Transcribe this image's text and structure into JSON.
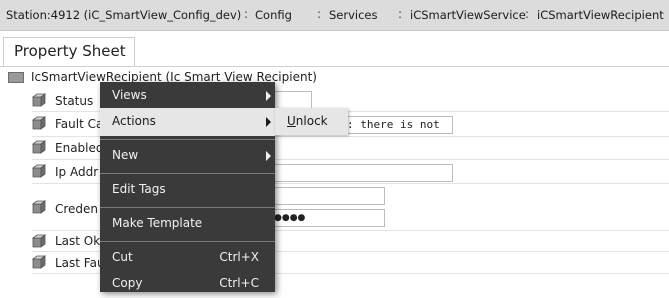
{
  "breadcrumb": {
    "station": "Station:4912 (iC_SmartView_Config_dev)",
    "items": [
      "Config",
      "Services",
      "iCSmartViewService",
      "iCSmartViewRecipient"
    ]
  },
  "tab": {
    "label": "Property Sheet"
  },
  "root": {
    "label": "IcSmartViewRecipient  (Ic Smart View Recipient)"
  },
  "properties": [
    {
      "label": "Status",
      "value": ""
    },
    {
      "label": "Fault Ca",
      "value": ": there is not"
    },
    {
      "label": "Enabled",
      "value": ""
    },
    {
      "label": "Ip Addr",
      "value": ""
    },
    {
      "label": "Creden",
      "value": "",
      "password": "●●●●"
    },
    {
      "label": "Last Ok",
      "value": ""
    },
    {
      "label": "Last Fau",
      "value": ""
    }
  ],
  "menu": {
    "views": "Views",
    "actions": "Actions",
    "new": "New",
    "edit_tags": "Edit Tags",
    "make_template": "Make Template",
    "cut": "Cut",
    "cut_shortcut": "Ctrl+X",
    "copy": "Copy",
    "copy_shortcut": "Ctrl+C"
  },
  "submenu": {
    "unlock_mnemonic": "U",
    "unlock_rest": "nlock"
  },
  "colors": {
    "menu_bg": "#3a3a3a",
    "menu_highlight": "#e6e6e6",
    "crumb_bg": "#dcdcdc"
  }
}
